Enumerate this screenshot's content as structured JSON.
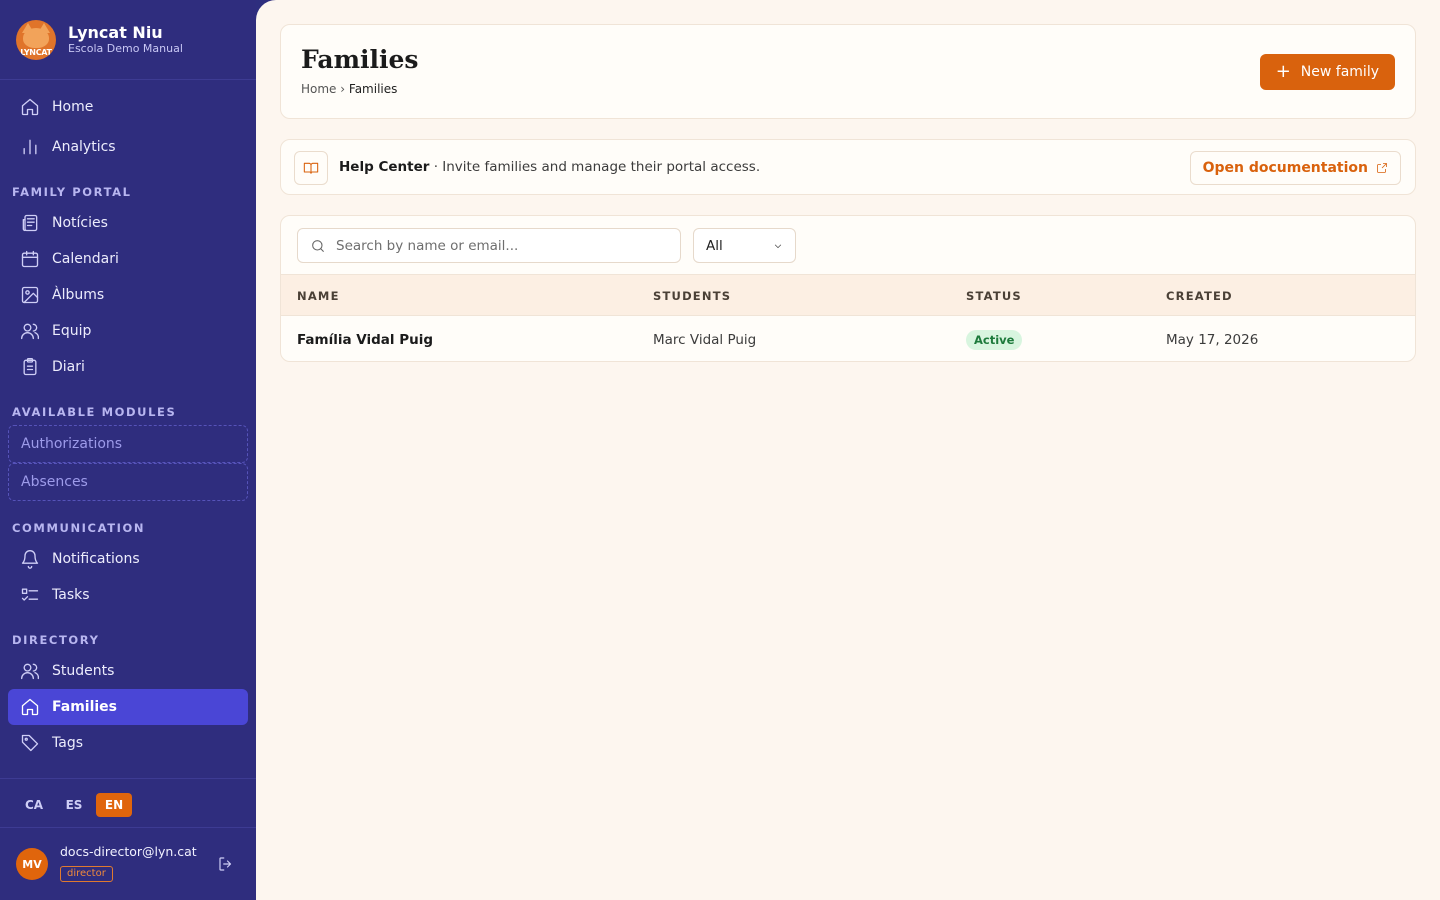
{
  "brand": {
    "name": "Lyncat Niu",
    "subtitle": "Escola Demo Manual",
    "logo_text": "LYNCAT"
  },
  "sidebar": {
    "top_items": [
      {
        "label": "Home",
        "icon": "home-icon"
      },
      {
        "label": "Analytics",
        "icon": "bar-chart-icon"
      }
    ],
    "sections": {
      "family_portal": "FAMILY PORTAL",
      "available_modules": "AVAILABLE MODULES",
      "communication": "COMMUNICATION",
      "directory": "DIRECTORY"
    },
    "family_portal_items": [
      {
        "label": "Notícies",
        "icon": "newspaper-icon"
      },
      {
        "label": "Calendari",
        "icon": "calendar-icon"
      },
      {
        "label": "Àlbums",
        "icon": "image-icon"
      },
      {
        "label": "Equip",
        "icon": "users-icon"
      },
      {
        "label": "Diari",
        "icon": "clipboard-icon"
      }
    ],
    "modules": [
      "Authorizations",
      "Absences"
    ],
    "communication_items": [
      {
        "label": "Notifications",
        "icon": "bell-icon"
      },
      {
        "label": "Tasks",
        "icon": "list-check-icon"
      }
    ],
    "directory_items": [
      {
        "label": "Students",
        "icon": "users-icon"
      },
      {
        "label": "Families",
        "icon": "home-icon",
        "active": true
      },
      {
        "label": "Tags",
        "icon": "tag-icon"
      }
    ],
    "languages": [
      "CA",
      "ES",
      "EN"
    ],
    "active_language": "EN",
    "user": {
      "initials": "MV",
      "email": "docs-director@lyn.cat",
      "role": "director"
    }
  },
  "header": {
    "title": "Families",
    "breadcrumb": {
      "home": "Home",
      "separator": "›",
      "current": "Families"
    },
    "new_button": "New family"
  },
  "help": {
    "title": "Help Center",
    "text": "· Invite families and manage their portal access.",
    "doc_button": "Open documentation"
  },
  "table": {
    "search_placeholder": "Search by name or email...",
    "filter_value": "All",
    "columns": [
      "NAME",
      "STUDENTS",
      "STATUS",
      "CREATED"
    ],
    "rows": [
      {
        "name": "Família Vidal Puig",
        "students": "Marc Vidal Puig",
        "status": "Active",
        "created": "May 17, 2026"
      }
    ]
  },
  "colors": {
    "sidebar_bg": "#2f2d7e",
    "active_nav": "#4a46d6",
    "accent": "#d9620d",
    "page_bg": "#fdf6ef",
    "status_active_bg": "#d8f5df"
  }
}
